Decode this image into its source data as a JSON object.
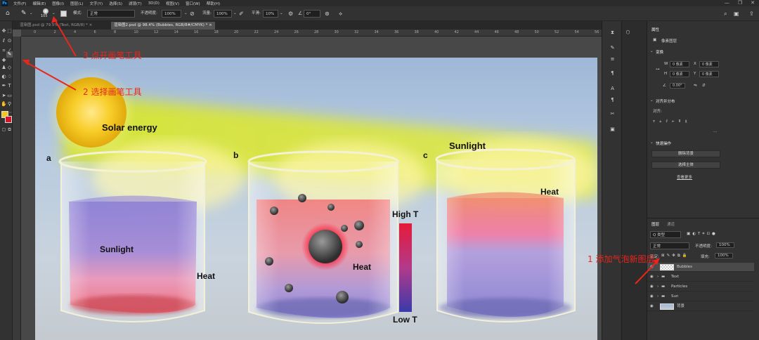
{
  "menubar": {
    "app_icon": "Ps",
    "items": [
      "文件(F)",
      "编辑(E)",
      "图像(I)",
      "图层(L)",
      "文字(Y)",
      "选择(S)",
      "滤镜(T)",
      "3D(D)",
      "视图(V)",
      "窗口(W)",
      "帮助(H)"
    ],
    "window_controls": [
      "—",
      "❐",
      "✕"
    ]
  },
  "options": {
    "brush_size": "105",
    "mode_label": "模式:",
    "mode_value": "正常",
    "opacity_label": "不透明度:",
    "opacity_value": "100%",
    "flow_label": "流量:",
    "flow_value": "100%",
    "smooth_label": "平滑:",
    "smooth_value": "10%",
    "angle_value": "0°"
  },
  "tabs": [
    {
      "label": "渲染图.psd @ 79.5% (Text, RGB/8) *"
    },
    {
      "label": "渲染图2.psd @ 98.4% (Bubbles, RGB/8#/CMYK) *"
    }
  ],
  "ruler_ticks": [
    "0",
    "2",
    "4",
    "6",
    "8",
    "10",
    "12",
    "14",
    "16",
    "18",
    "20",
    "22",
    "24",
    "26",
    "28",
    "30",
    "32",
    "34",
    "36",
    "38",
    "40",
    "42",
    "44",
    "46",
    "48",
    "50",
    "52",
    "54",
    "56"
  ],
  "canvas": {
    "solar": "Solar energy",
    "label_a": "a",
    "label_b": "b",
    "label_c": "c",
    "sunlight_a": "Sunlight",
    "heat_a": "Heat",
    "heat_b": "Heat",
    "high_t": "High T",
    "low_t": "Low T",
    "sunlight_c": "Sunlight",
    "heat_c": "Heat"
  },
  "annotations": {
    "step1": "1 添加气泡新图层",
    "step2": "2 选择画笔工具",
    "step3": "3 点开画笔工具"
  },
  "properties": {
    "title": "属性",
    "subtitle": "像素图层",
    "transform": "变换",
    "w_label": "W",
    "h_label": "H",
    "x_label": "X",
    "y_label": "Y",
    "w_value": "0 像素",
    "h_value": "0 像素",
    "x_value": "0 像素",
    "y_value": "0 像素",
    "angle_value": "0.00°",
    "align": "对齐并分布",
    "align_sub": "对齐:",
    "more": "...",
    "quick": "快速操作",
    "btn_remove_bg": "删除背景",
    "btn_select_subject": "选择主体",
    "link_more": "查看更多"
  },
  "layers_panel": {
    "tab_layers": "图层",
    "tab_channels": "通道",
    "filter_kind": "Q 类型",
    "blend_mode": "正常",
    "opacity_label": "不透明度:",
    "opacity_value": "100%",
    "lock_label": "锁定:",
    "fill_label": "填充:",
    "fill_value": "100%",
    "layers": [
      {
        "name": "Bubbles",
        "type": "pixel",
        "selected": true
      },
      {
        "name": "Text",
        "type": "group",
        "selected": false
      },
      {
        "name": "Particles",
        "type": "group",
        "selected": false
      },
      {
        "name": "Sun",
        "type": "group",
        "selected": false
      },
      {
        "name": "背景",
        "type": "pixel",
        "selected": false
      }
    ]
  },
  "colors": {
    "foreground": "#f5c518",
    "background": "#d0172b",
    "annotation": "#e8261c"
  }
}
